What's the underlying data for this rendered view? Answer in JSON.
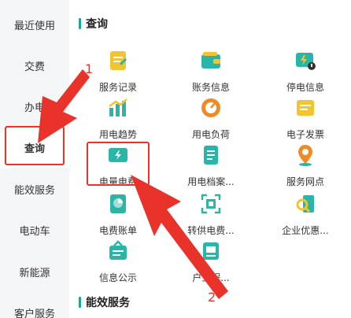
{
  "sidebar": {
    "items": [
      {
        "label": "最近使用"
      },
      {
        "label": "交费"
      },
      {
        "label": "办电"
      },
      {
        "label": "查询"
      },
      {
        "label": "能效服务"
      },
      {
        "label": "电动车"
      },
      {
        "label": "新能源"
      },
      {
        "label": "客户服务"
      }
    ],
    "active_index": 3
  },
  "sections": {
    "query_title": "查询",
    "energy_title": "能效服务"
  },
  "services": [
    {
      "label": "服务记录",
      "icon": "clipboard-icon"
    },
    {
      "label": "账务信息",
      "icon": "wallet-icon"
    },
    {
      "label": "停电信息",
      "icon": "power-outage-icon"
    },
    {
      "label": "用电趋势",
      "icon": "trend-chart-icon"
    },
    {
      "label": "用电负荷",
      "icon": "gauge-icon"
    },
    {
      "label": "电子发票",
      "icon": "invoice-icon"
    },
    {
      "label": "电量电费",
      "icon": "battery-icon"
    },
    {
      "label": "用电档案...",
      "icon": "document-icon"
    },
    {
      "label": "服务网点",
      "icon": "location-pin-icon"
    },
    {
      "label": "电费账单",
      "icon": "bill-icon"
    },
    {
      "label": "转供电费...",
      "icon": "qr-scan-icon"
    },
    {
      "label": "企业优惠...",
      "icon": "search-building-icon"
    },
    {
      "label": "信息公示",
      "icon": "notice-board-icon"
    },
    {
      "label": "户工程...",
      "icon": "project-icon"
    }
  ],
  "annotations": {
    "step1": "1",
    "step2": "2"
  },
  "colors": {
    "accent": "#17a89a",
    "annotation": "#e8322a",
    "yellow": "#f4c430",
    "teal": "#2bb5a8",
    "orange": "#f08a24"
  }
}
